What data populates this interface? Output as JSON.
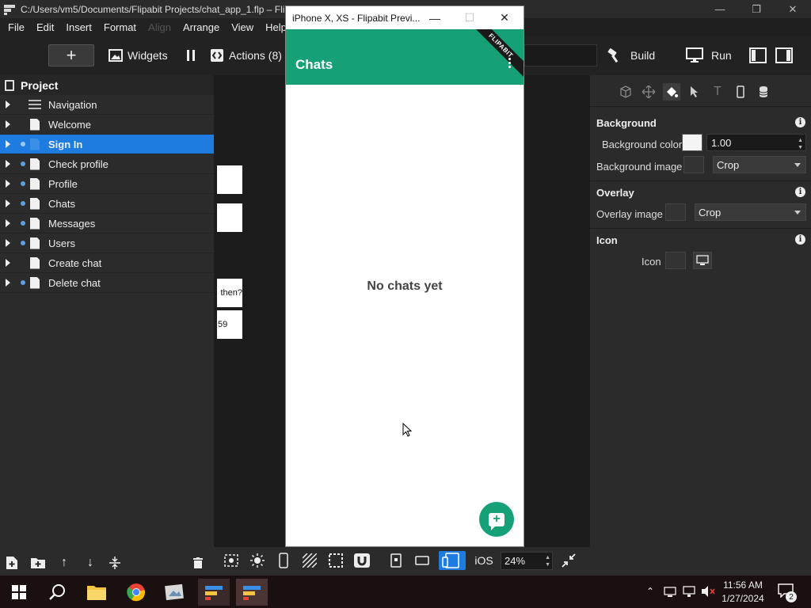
{
  "window": {
    "title": "C:/Users/vm5/Documents/Flipabit Projects/chat_app_1.flp – Flip",
    "controls": [
      "—",
      "❐",
      "✕"
    ]
  },
  "menu": {
    "items": [
      "File",
      "Edit",
      "Insert",
      "Format",
      "Align",
      "Arrange",
      "View",
      "Help"
    ]
  },
  "toolbar": {
    "add_label": "+",
    "widgets_label": "Widgets",
    "actions_label": "Actions (8)",
    "build_label": "Build",
    "run_label": "Run"
  },
  "project": {
    "title": "Project",
    "items": [
      {
        "label": "Navigation",
        "type": "nav"
      },
      {
        "label": "Welcome",
        "type": "page"
      },
      {
        "label": "Sign In",
        "type": "page",
        "selected": true
      },
      {
        "label": "Check profile",
        "type": "page"
      },
      {
        "label": "Profile",
        "type": "page"
      },
      {
        "label": "Chats",
        "type": "page"
      },
      {
        "label": "Messages",
        "type": "page"
      },
      {
        "label": "Users",
        "type": "page"
      },
      {
        "label": "Create chat",
        "type": "page"
      },
      {
        "label": "Delete chat",
        "type": "page"
      }
    ]
  },
  "canvas": {
    "card_text_1": "then?",
    "card_text_2": "59"
  },
  "preview": {
    "title": "iPhone X, XS - Flipabit Previ...",
    "ribbon": "FLIPABIT",
    "header_title": "Chats",
    "empty_text": "No chats yet",
    "fab_icon": "+",
    "accent": "#15a077"
  },
  "canvas_toolbar": {
    "platform_label": "iOS",
    "zoom": "24%"
  },
  "props": {
    "background": {
      "title": "Background",
      "color_label": "Background color",
      "opacity": "1.00",
      "image_label": "Background image",
      "image_mode": "Crop"
    },
    "overlay": {
      "title": "Overlay",
      "image_label": "Overlay image",
      "image_mode": "Crop"
    },
    "icon": {
      "title": "Icon",
      "label": "Icon"
    },
    "info_glyph": "i"
  },
  "taskbar": {
    "time": "11:56 AM",
    "date": "1/27/2024",
    "notifications": "2"
  }
}
